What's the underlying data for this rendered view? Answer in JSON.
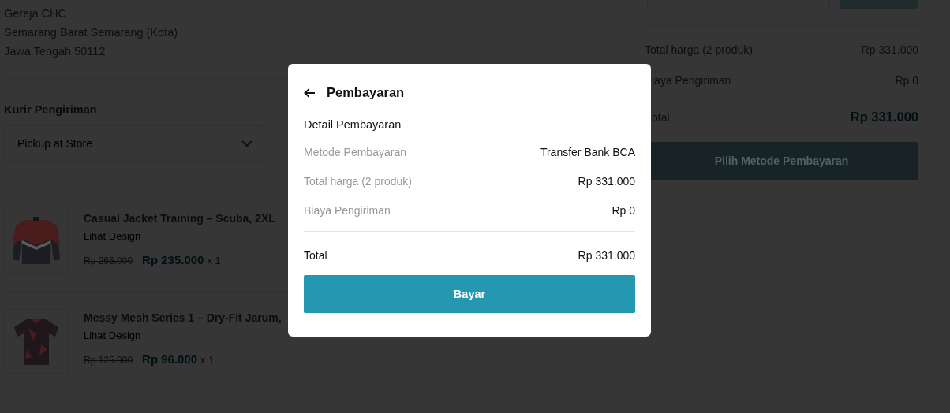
{
  "address": {
    "lines": [
      "Gereja CHC",
      "Semarang Barat Semarang (Kota)",
      "Jawa Tengah 50112"
    ]
  },
  "courier": {
    "heading": "Kurir Pengiriman",
    "dropdown": {
      "value": "Pickup at Store"
    }
  },
  "products": [
    {
      "name": "Casual Jacket Training – Scuba, 2XL",
      "link": "Lihat Design",
      "old_price": "Rp 265.000",
      "price": "Rp 235.000",
      "quantity": "x 1",
      "kind": "jacket"
    },
    {
      "name": "Messy Mesh Series 1 – Dry-Fit Jarum,",
      "link": "Lihat Design",
      "old_price": "Rp 125.000",
      "price": "Rp 96.000",
      "quantity": "x 1",
      "kind": "shirt"
    }
  ],
  "summary": {
    "rows": [
      {
        "label": "Total harga (2 produk)",
        "value": "Rp 331.000"
      },
      {
        "label": "iaya Pengiriman",
        "value": "Rp 0"
      }
    ],
    "total": {
      "label": "otal",
      "value": "Rp 331.000"
    },
    "button": "Pilih Metode Pembayaran"
  },
  "modal": {
    "title": "Pembayaran",
    "section": "Detail Pembayaran",
    "rows": [
      {
        "label": "Metode Pembayaran",
        "value": "Transfer Bank BCA"
      },
      {
        "label": "Total harga (2 produk)",
        "value": "Rp 331.000"
      },
      {
        "label": "Biaya Pengiriman",
        "value": "Rp 0"
      }
    ],
    "total": {
      "label": "Total",
      "value": "Rp 331.000"
    },
    "button": "Bayar"
  }
}
